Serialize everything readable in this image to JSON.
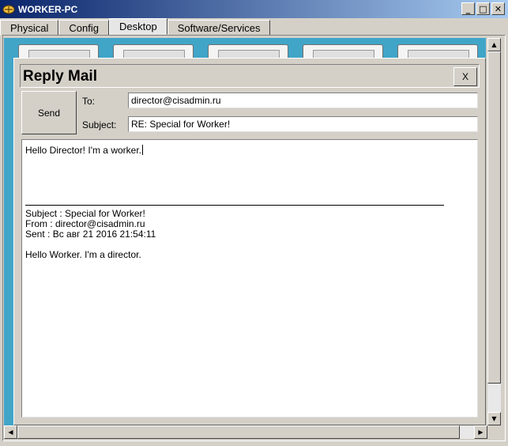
{
  "window": {
    "title": "WORKER-PC",
    "icon": "packet-tracer-icon",
    "controls": [
      "_",
      "□",
      "✕"
    ]
  },
  "tabs": [
    {
      "label": "Physical",
      "active": false
    },
    {
      "label": "Config",
      "active": false
    },
    {
      "label": "Desktop",
      "active": true
    },
    {
      "label": "Software/Services",
      "active": false
    }
  ],
  "dialog": {
    "title": "Reply Mail",
    "close_label": "X",
    "send_label": "Send",
    "to_label": "To:",
    "to_value": "director@cisadmin.ru",
    "subject_label": "Subject:",
    "subject_value": "RE: Special for Worker!",
    "body": {
      "reply_text": "Hello Director! I'm a worker.",
      "quoted_subject": "Subject : Special for Worker!",
      "quoted_from": "From : director@cisadmin.ru",
      "quoted_sent": "Sent : Вс авг 21 2016 21:54:11",
      "quoted_message": "Hello Worker. I'm a director."
    }
  },
  "colors": {
    "desktop_background": "#41a5c8",
    "titlebar_start": "#0a246a",
    "titlebar_end": "#a6caf0",
    "chrome": "#d4d0c8"
  }
}
